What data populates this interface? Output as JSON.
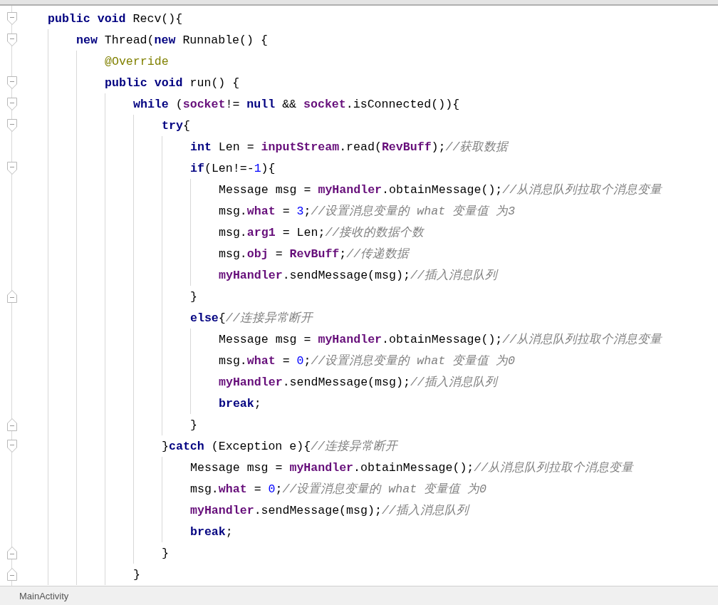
{
  "editor": {
    "lines": [
      {
        "fold_start": true,
        "fold_end": false,
        "tokens": [
          {
            "kind": "kw",
            "text": "public void"
          },
          {
            "kind": "plain",
            "text": " Recv(){"
          }
        ],
        "children": [
          {
            "fold_start": true,
            "fold_end": false,
            "tokens": [
              {
                "kind": "kw",
                "text": "new"
              },
              {
                "kind": "plain",
                "text": " Thread("
              },
              {
                "kind": "kw",
                "text": "new"
              },
              {
                "kind": "plain",
                "text": " Runnable() {"
              }
            ],
            "children": [
              {
                "fold_start": false,
                "fold_end": false,
                "tokens": [
                  {
                    "kind": "ann",
                    "text": "@Override"
                  }
                ]
              },
              {
                "fold_start": true,
                "fold_end": false,
                "tokens": [
                  {
                    "kind": "kw",
                    "text": "public void"
                  },
                  {
                    "kind": "plain",
                    "text": " run() {"
                  }
                ],
                "children": [
                  {
                    "fold_start": true,
                    "fold_end": false,
                    "tokens": [
                      {
                        "kind": "kw",
                        "text": "while"
                      },
                      {
                        "kind": "plain",
                        "text": " ("
                      },
                      {
                        "kind": "field",
                        "text": "socket"
                      },
                      {
                        "kind": "plain",
                        "text": "!= "
                      },
                      {
                        "kind": "kw",
                        "text": "null"
                      },
                      {
                        "kind": "plain",
                        "text": " && "
                      },
                      {
                        "kind": "field",
                        "text": "socket"
                      },
                      {
                        "kind": "plain",
                        "text": ".isConnected()){"
                      }
                    ],
                    "children": [
                      {
                        "fold_start": true,
                        "fold_end": false,
                        "tokens": [
                          {
                            "kind": "kw",
                            "text": "try"
                          },
                          {
                            "kind": "plain",
                            "text": "{"
                          }
                        ],
                        "children": [
                          {
                            "fold_start": false,
                            "fold_end": false,
                            "tokens": [
                              {
                                "kind": "kw",
                                "text": "int"
                              },
                              {
                                "kind": "plain",
                                "text": " Len = "
                              },
                              {
                                "kind": "field",
                                "text": "inputStream"
                              },
                              {
                                "kind": "plain",
                                "text": ".read("
                              },
                              {
                                "kind": "field",
                                "text": "RevBuff"
                              },
                              {
                                "kind": "plain",
                                "text": ");"
                              },
                              {
                                "kind": "comment",
                                "text": "//获取数据"
                              }
                            ]
                          },
                          {
                            "fold_start": true,
                            "fold_end": false,
                            "tokens": [
                              {
                                "kind": "kw",
                                "text": "if"
                              },
                              {
                                "kind": "plain",
                                "text": "(Len!=-"
                              },
                              {
                                "kind": "num",
                                "text": "1"
                              },
                              {
                                "kind": "plain",
                                "text": "){"
                              }
                            ],
                            "children": [
                              {
                                "fold_start": false,
                                "fold_end": false,
                                "tokens": [
                                  {
                                    "kind": "plain",
                                    "text": "Message msg = "
                                  },
                                  {
                                    "kind": "field",
                                    "text": "myHandler"
                                  },
                                  {
                                    "kind": "plain",
                                    "text": ".obtainMessage();"
                                  },
                                  {
                                    "kind": "comment",
                                    "text": "//从消息队列拉取个消息变量"
                                  }
                                ]
                              },
                              {
                                "fold_start": false,
                                "fold_end": false,
                                "tokens": [
                                  {
                                    "kind": "plain",
                                    "text": "msg."
                                  },
                                  {
                                    "kind": "field",
                                    "text": "what"
                                  },
                                  {
                                    "kind": "plain",
                                    "text": " = "
                                  },
                                  {
                                    "kind": "num",
                                    "text": "3"
                                  },
                                  {
                                    "kind": "plain",
                                    "text": ";"
                                  },
                                  {
                                    "kind": "comment",
                                    "text": "//设置消息变量的 what 变量值 为3"
                                  }
                                ]
                              },
                              {
                                "fold_start": false,
                                "fold_end": false,
                                "tokens": [
                                  {
                                    "kind": "plain",
                                    "text": "msg."
                                  },
                                  {
                                    "kind": "field",
                                    "text": "arg1"
                                  },
                                  {
                                    "kind": "plain",
                                    "text": " = Len;"
                                  },
                                  {
                                    "kind": "comment",
                                    "text": "//接收的数据个数"
                                  }
                                ]
                              },
                              {
                                "fold_start": false,
                                "fold_end": false,
                                "tokens": [
                                  {
                                    "kind": "plain",
                                    "text": "msg."
                                  },
                                  {
                                    "kind": "field",
                                    "text": "obj"
                                  },
                                  {
                                    "kind": "plain",
                                    "text": " = "
                                  },
                                  {
                                    "kind": "field",
                                    "text": "RevBuff"
                                  },
                                  {
                                    "kind": "plain",
                                    "text": ";"
                                  },
                                  {
                                    "kind": "comment",
                                    "text": "//传递数据"
                                  }
                                ]
                              },
                              {
                                "fold_start": false,
                                "fold_end": false,
                                "tokens": [
                                  {
                                    "kind": "field",
                                    "text": "myHandler"
                                  },
                                  {
                                    "kind": "plain",
                                    "text": ".sendMessage(msg);"
                                  },
                                  {
                                    "kind": "comment",
                                    "text": "//插入消息队列"
                                  }
                                ]
                              }
                            ]
                          },
                          {
                            "fold_start": false,
                            "fold_end": true,
                            "tokens": [
                              {
                                "kind": "plain",
                                "text": "}"
                              }
                            ]
                          },
                          {
                            "fold_start": false,
                            "fold_end": false,
                            "tokens": [
                              {
                                "kind": "kw",
                                "text": "else"
                              },
                              {
                                "kind": "plain",
                                "text": "{"
                              },
                              {
                                "kind": "comment",
                                "text": "//连接异常断开"
                              }
                            ],
                            "children": [
                              {
                                "fold_start": false,
                                "fold_end": false,
                                "tokens": [
                                  {
                                    "kind": "plain",
                                    "text": "Message msg = "
                                  },
                                  {
                                    "kind": "field",
                                    "text": "myHandler"
                                  },
                                  {
                                    "kind": "plain",
                                    "text": ".obtainMessage();"
                                  },
                                  {
                                    "kind": "comment",
                                    "text": "//从消息队列拉取个消息变量"
                                  }
                                ]
                              },
                              {
                                "fold_start": false,
                                "fold_end": false,
                                "tokens": [
                                  {
                                    "kind": "plain",
                                    "text": "msg."
                                  },
                                  {
                                    "kind": "field",
                                    "text": "what"
                                  },
                                  {
                                    "kind": "plain",
                                    "text": " = "
                                  },
                                  {
                                    "kind": "num",
                                    "text": "0"
                                  },
                                  {
                                    "kind": "plain",
                                    "text": ";"
                                  },
                                  {
                                    "kind": "comment",
                                    "text": "//设置消息变量的 what 变量值 为0"
                                  }
                                ]
                              },
                              {
                                "fold_start": false,
                                "fold_end": false,
                                "tokens": [
                                  {
                                    "kind": "field",
                                    "text": "myHandler"
                                  },
                                  {
                                    "kind": "plain",
                                    "text": ".sendMessage(msg);"
                                  },
                                  {
                                    "kind": "comment",
                                    "text": "//插入消息队列"
                                  }
                                ]
                              },
                              {
                                "fold_start": false,
                                "fold_end": false,
                                "tokens": [
                                  {
                                    "kind": "kw",
                                    "text": "break"
                                  },
                                  {
                                    "kind": "plain",
                                    "text": ";"
                                  }
                                ]
                              }
                            ]
                          },
                          {
                            "fold_start": false,
                            "fold_end": true,
                            "tokens": [
                              {
                                "kind": "plain",
                                "text": "}"
                              }
                            ]
                          }
                        ]
                      },
                      {
                        "fold_start": true,
                        "fold_end": false,
                        "tokens": [
                          {
                            "kind": "plain",
                            "text": "}"
                          },
                          {
                            "kind": "kw",
                            "text": "catch"
                          },
                          {
                            "kind": "plain",
                            "text": " (Exception e){"
                          },
                          {
                            "kind": "comment",
                            "text": "//连接异常断开"
                          }
                        ],
                        "children": [
                          {
                            "fold_start": false,
                            "fold_end": false,
                            "tokens": [
                              {
                                "kind": "plain",
                                "text": "Message msg = "
                              },
                              {
                                "kind": "field",
                                "text": "myHandler"
                              },
                              {
                                "kind": "plain",
                                "text": ".obtainMessage();"
                              },
                              {
                                "kind": "comment",
                                "text": "//从消息队列拉取个消息变量"
                              }
                            ]
                          },
                          {
                            "fold_start": false,
                            "fold_end": false,
                            "tokens": [
                              {
                                "kind": "plain",
                                "text": "msg."
                              },
                              {
                                "kind": "field",
                                "text": "what"
                              },
                              {
                                "kind": "plain",
                                "text": " = "
                              },
                              {
                                "kind": "num",
                                "text": "0"
                              },
                              {
                                "kind": "plain",
                                "text": ";"
                              },
                              {
                                "kind": "comment",
                                "text": "//设置消息变量的 what 变量值 为0"
                              }
                            ]
                          },
                          {
                            "fold_start": false,
                            "fold_end": false,
                            "tokens": [
                              {
                                "kind": "field",
                                "text": "myHandler"
                              },
                              {
                                "kind": "plain",
                                "text": ".sendMessage(msg);"
                              },
                              {
                                "kind": "comment",
                                "text": "//插入消息队列"
                              }
                            ]
                          },
                          {
                            "fold_start": false,
                            "fold_end": false,
                            "tokens": [
                              {
                                "kind": "kw",
                                "text": "break"
                              },
                              {
                                "kind": "plain",
                                "text": ";"
                              }
                            ]
                          }
                        ]
                      },
                      {
                        "fold_start": false,
                        "fold_end": true,
                        "tokens": [
                          {
                            "kind": "plain",
                            "text": "}"
                          }
                        ]
                      }
                    ]
                  },
                  {
                    "fold_start": false,
                    "fold_end": true,
                    "tokens": [
                      {
                        "kind": "plain",
                        "text": "}"
                      }
                    ]
                  }
                ]
              }
            ]
          }
        ]
      }
    ]
  },
  "breadcrumb": "MainActivity"
}
